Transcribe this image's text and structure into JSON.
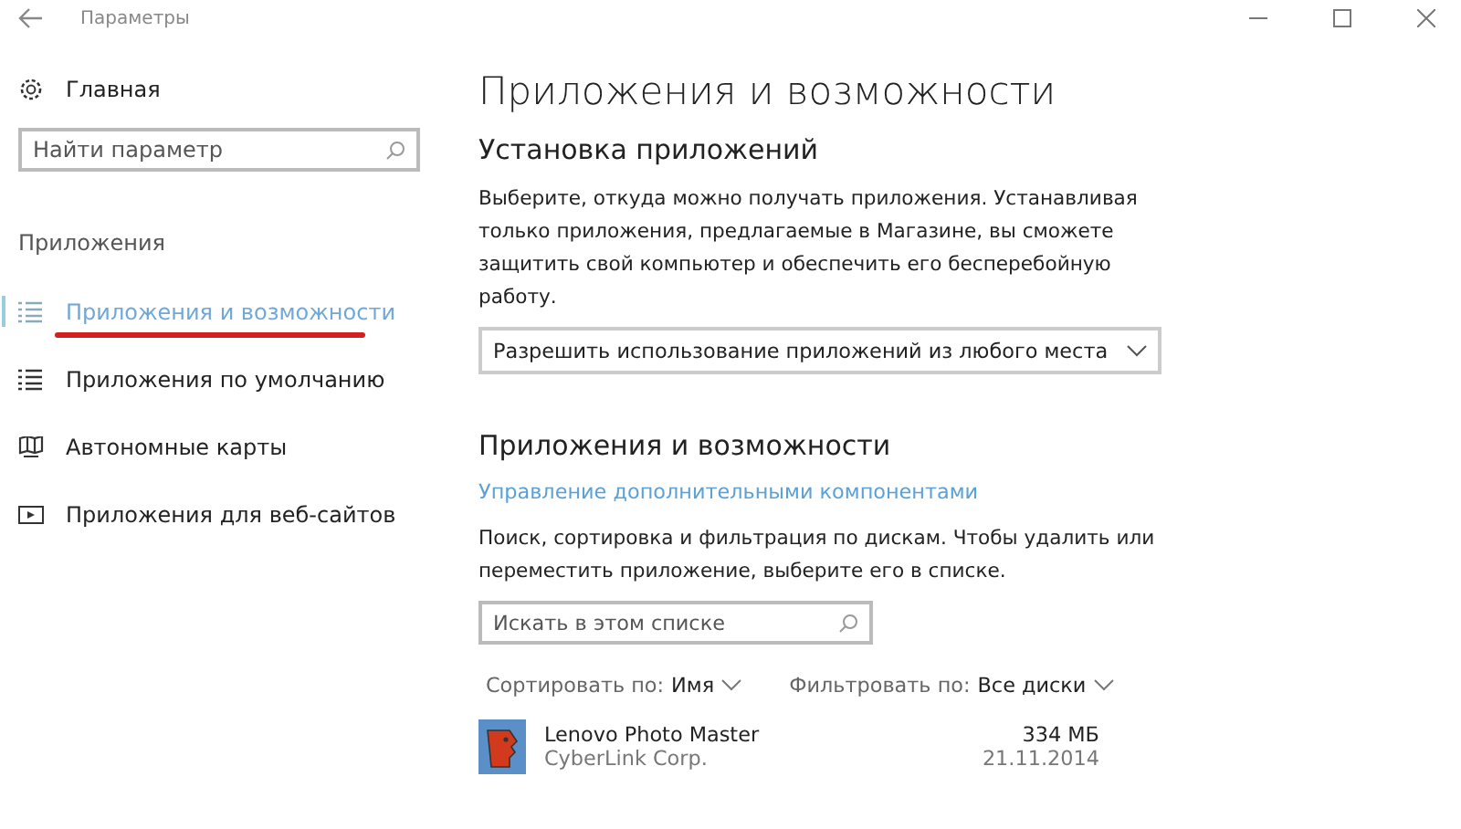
{
  "window": {
    "title": "Параметры"
  },
  "sidebar": {
    "home": "Главная",
    "search": {
      "placeholder": "Найти параметр"
    },
    "section": "Приложения",
    "items": [
      {
        "label": "Приложения и возможности",
        "kind": "list",
        "selected": true
      },
      {
        "label": "Приложения по умолчанию",
        "kind": "defaults",
        "selected": false
      },
      {
        "label": "Автономные карты",
        "kind": "map",
        "selected": false
      },
      {
        "label": "Приложения для веб-сайтов",
        "kind": "web",
        "selected": false
      }
    ]
  },
  "page": {
    "title": "Приложения и возможности",
    "install": {
      "heading": "Установка приложений",
      "text": "Выберите, откуда можно получать приложения. Устанавливая только приложения, предлагаемые в Магазине, вы сможете защитить свой компьютер и обеспечить его бесперебойную работу.",
      "dropdown": "Разрешить использование приложений из любого места"
    },
    "apps": {
      "heading": "Приложения и возможности",
      "link": "Управление дополнительными компонентами",
      "text": "Поиск, сортировка и фильтрация по дискам. Чтобы удалить или переместить приложение, выберите его в списке.",
      "search": {
        "placeholder": "Искать в этом списке"
      },
      "sort": {
        "label": "Сортировать по:",
        "value": "Имя"
      },
      "filter": {
        "label": "Фильтровать по:",
        "value": "Все диски"
      },
      "list": [
        {
          "name": "Lenovo Photo Master",
          "publisher": "CyberLink Corp.",
          "size": "334 МБ",
          "date": "21.11.2014"
        }
      ]
    }
  }
}
